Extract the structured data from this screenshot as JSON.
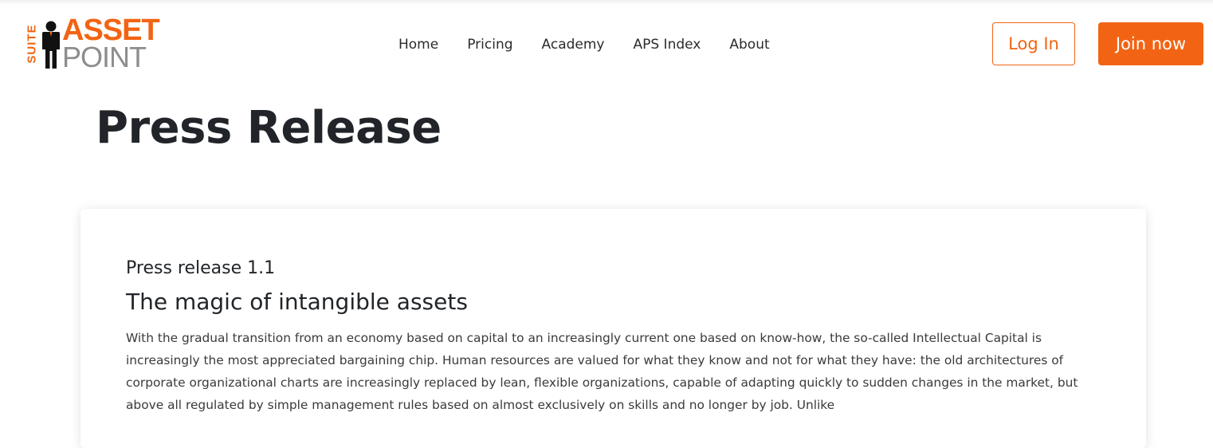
{
  "logo": {
    "suite": "SUITE",
    "asset": "ASSET",
    "point": "POINT",
    "brand_color": "#f26413",
    "gray_color": "#8d8d8d",
    "icon": "person-icon"
  },
  "nav": {
    "items": [
      "Home",
      "Pricing",
      "Academy",
      "APS Index",
      "About"
    ]
  },
  "actions": {
    "login_label": "Log In",
    "join_label": "Join now"
  },
  "page": {
    "title": "Press Release"
  },
  "article": {
    "kicker": "Press release 1.1",
    "headline": "The magic of intangible assets",
    "body": "With the gradual transition from an economy based on capital to an increasingly current one based on know-how, the so-called Intellectual Capital is increasingly the most appreciated bargaining chip. Human resources are valued for what they know and not for what they have: the old architectures of corporate organizational charts are increasingly replaced by lean, flexible organizations, capable of adapting quickly to sudden changes in the market, but above all regulated by simple management rules based on almost exclusively on skills and no longer by job. Unlike"
  }
}
